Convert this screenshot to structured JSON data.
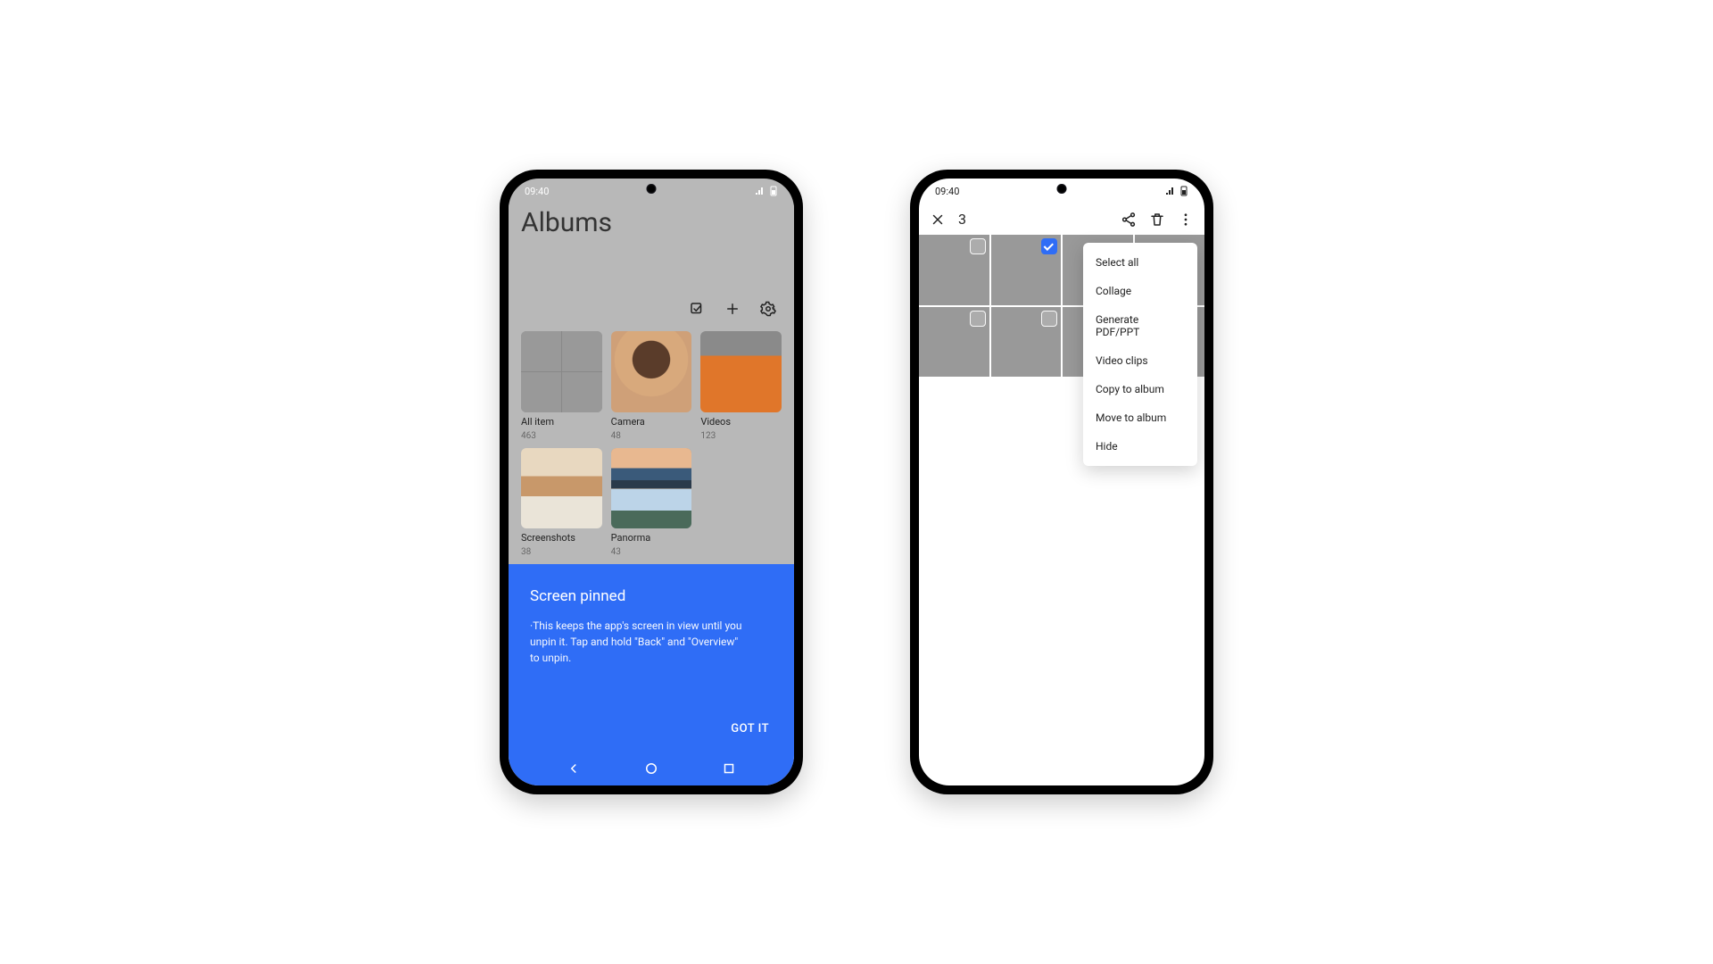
{
  "status_time": "09:40",
  "phone1": {
    "title": "Albums",
    "albums": [
      {
        "name": "All item",
        "count": "463"
      },
      {
        "name": "Camera",
        "count": "48"
      },
      {
        "name": "Videos",
        "count": "123"
      },
      {
        "name": "Screenshots",
        "count": "38"
      },
      {
        "name": "Panorma",
        "count": "43"
      }
    ],
    "sheet": {
      "title": "Screen pinned",
      "body": "·This keeps the app's screen in view until you unpin it. Tap and hold \"Back\" and \"Overview\" to unpin.",
      "button": "GOT IT"
    }
  },
  "phone2": {
    "selected_count": "3",
    "menu": [
      "Select all",
      "Collage",
      "Generate PDF/PPT",
      "Video clips",
      "Copy to album",
      "Move to album",
      "Hide"
    ]
  }
}
